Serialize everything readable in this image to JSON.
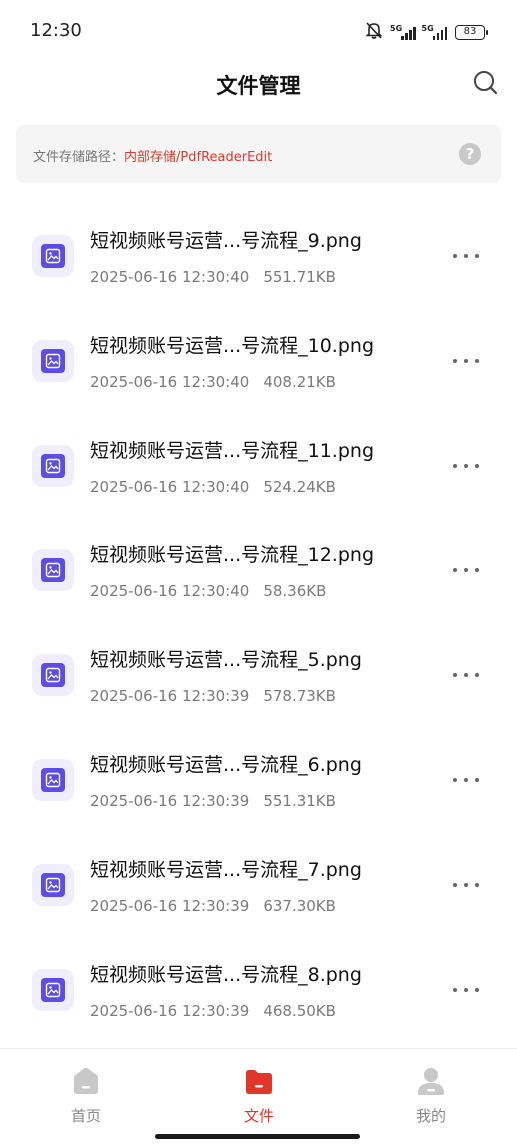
{
  "status_bar": {
    "time": "12:30",
    "signal_1_label": "5G",
    "signal_2_label": "5G",
    "battery": "83"
  },
  "header": {
    "title": "文件管理"
  },
  "storage_path": {
    "label": "文件存储路径：",
    "value": "内部存储/PdfReaderEdit"
  },
  "files": [
    {
      "name": "短视频账号运营...号流程_9.png",
      "date": "2025-06-16 12:30:40",
      "size": "551.71KB"
    },
    {
      "name": "短视频账号运营...号流程_10.png",
      "date": "2025-06-16 12:30:40",
      "size": "408.21KB"
    },
    {
      "name": "短视频账号运营...号流程_11.png",
      "date": "2025-06-16 12:30:40",
      "size": "524.24KB"
    },
    {
      "name": "短视频账号运营...号流程_12.png",
      "date": "2025-06-16 12:30:40",
      "size": "58.36KB"
    },
    {
      "name": "短视频账号运营...号流程_5.png",
      "date": "2025-06-16 12:30:39",
      "size": "578.73KB"
    },
    {
      "name": "短视频账号运营...号流程_6.png",
      "date": "2025-06-16 12:30:39",
      "size": "551.31KB"
    },
    {
      "name": "短视频账号运营...号流程_7.png",
      "date": "2025-06-16 12:30:39",
      "size": "637.30KB"
    },
    {
      "name": "短视频账号运营...号流程_8.png",
      "date": "2025-06-16 12:30:39",
      "size": "468.50KB"
    }
  ],
  "tab_bar": {
    "items": [
      {
        "label": "首页",
        "icon": "home-icon",
        "active": false
      },
      {
        "label": "文件",
        "icon": "folder-icon",
        "active": true
      },
      {
        "label": "我的",
        "icon": "profile-icon",
        "active": false
      }
    ]
  },
  "colors": {
    "accent": "#e0372b",
    "path_value": "#d63b2f",
    "file_icon": "#5c4de6",
    "inactive_tab": "#c8c8c8"
  }
}
